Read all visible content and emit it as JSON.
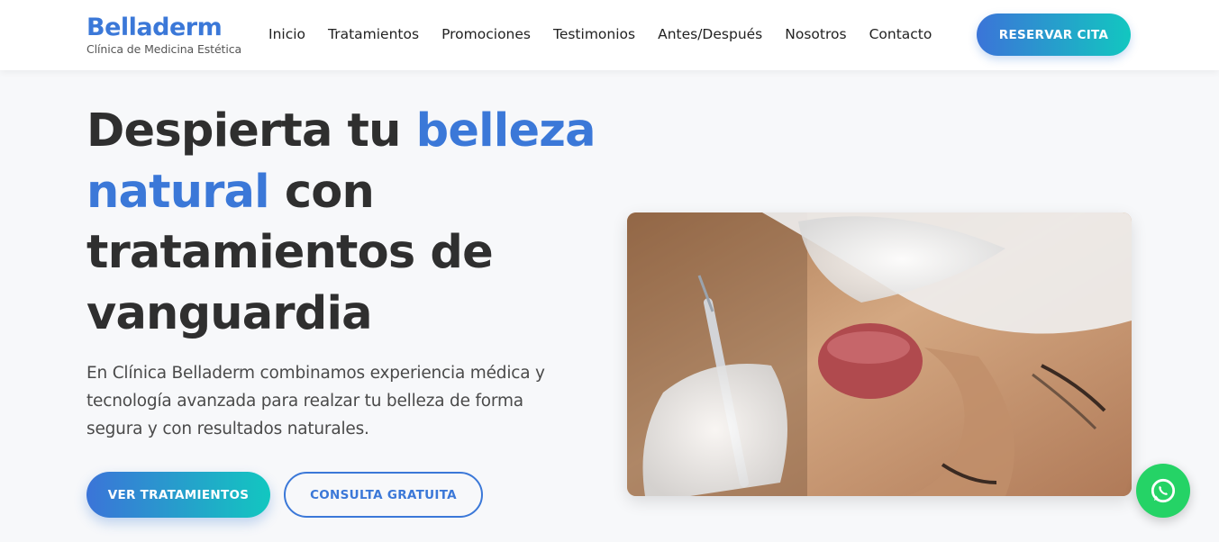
{
  "header": {
    "brand": "Belladerm",
    "tagline": "Clínica de Medicina Estética",
    "nav": [
      "Inicio",
      "Tratamientos",
      "Promociones",
      "Testimonios",
      "Antes/Después",
      "Nosotros",
      "Contacto"
    ],
    "cta": "RESERVAR CITA"
  },
  "hero": {
    "title_part1": "Despierta tu ",
    "title_accent1": "belleza",
    "title_accent2": "natural",
    "title_part2": " con",
    "title_line3": "tratamientos de",
    "title_line4": "vanguardia",
    "description": "En Clínica Belladerm combinamos experiencia médica y tecnología avanzada para realzar tu belleza de forma segura y con resultados naturales.",
    "primary_button": "VER TRATAMIENTOS",
    "secondary_button": "CONSULTA GRATUITA"
  },
  "image": {
    "icon": "photo-lip-injection"
  },
  "whatsapp": {
    "icon": "whatsapp-icon"
  },
  "colors": {
    "accent": "#3b78d8",
    "gradient_start": "#3b74d8",
    "gradient_end": "#12c7c0",
    "whatsapp": "#25d366"
  }
}
